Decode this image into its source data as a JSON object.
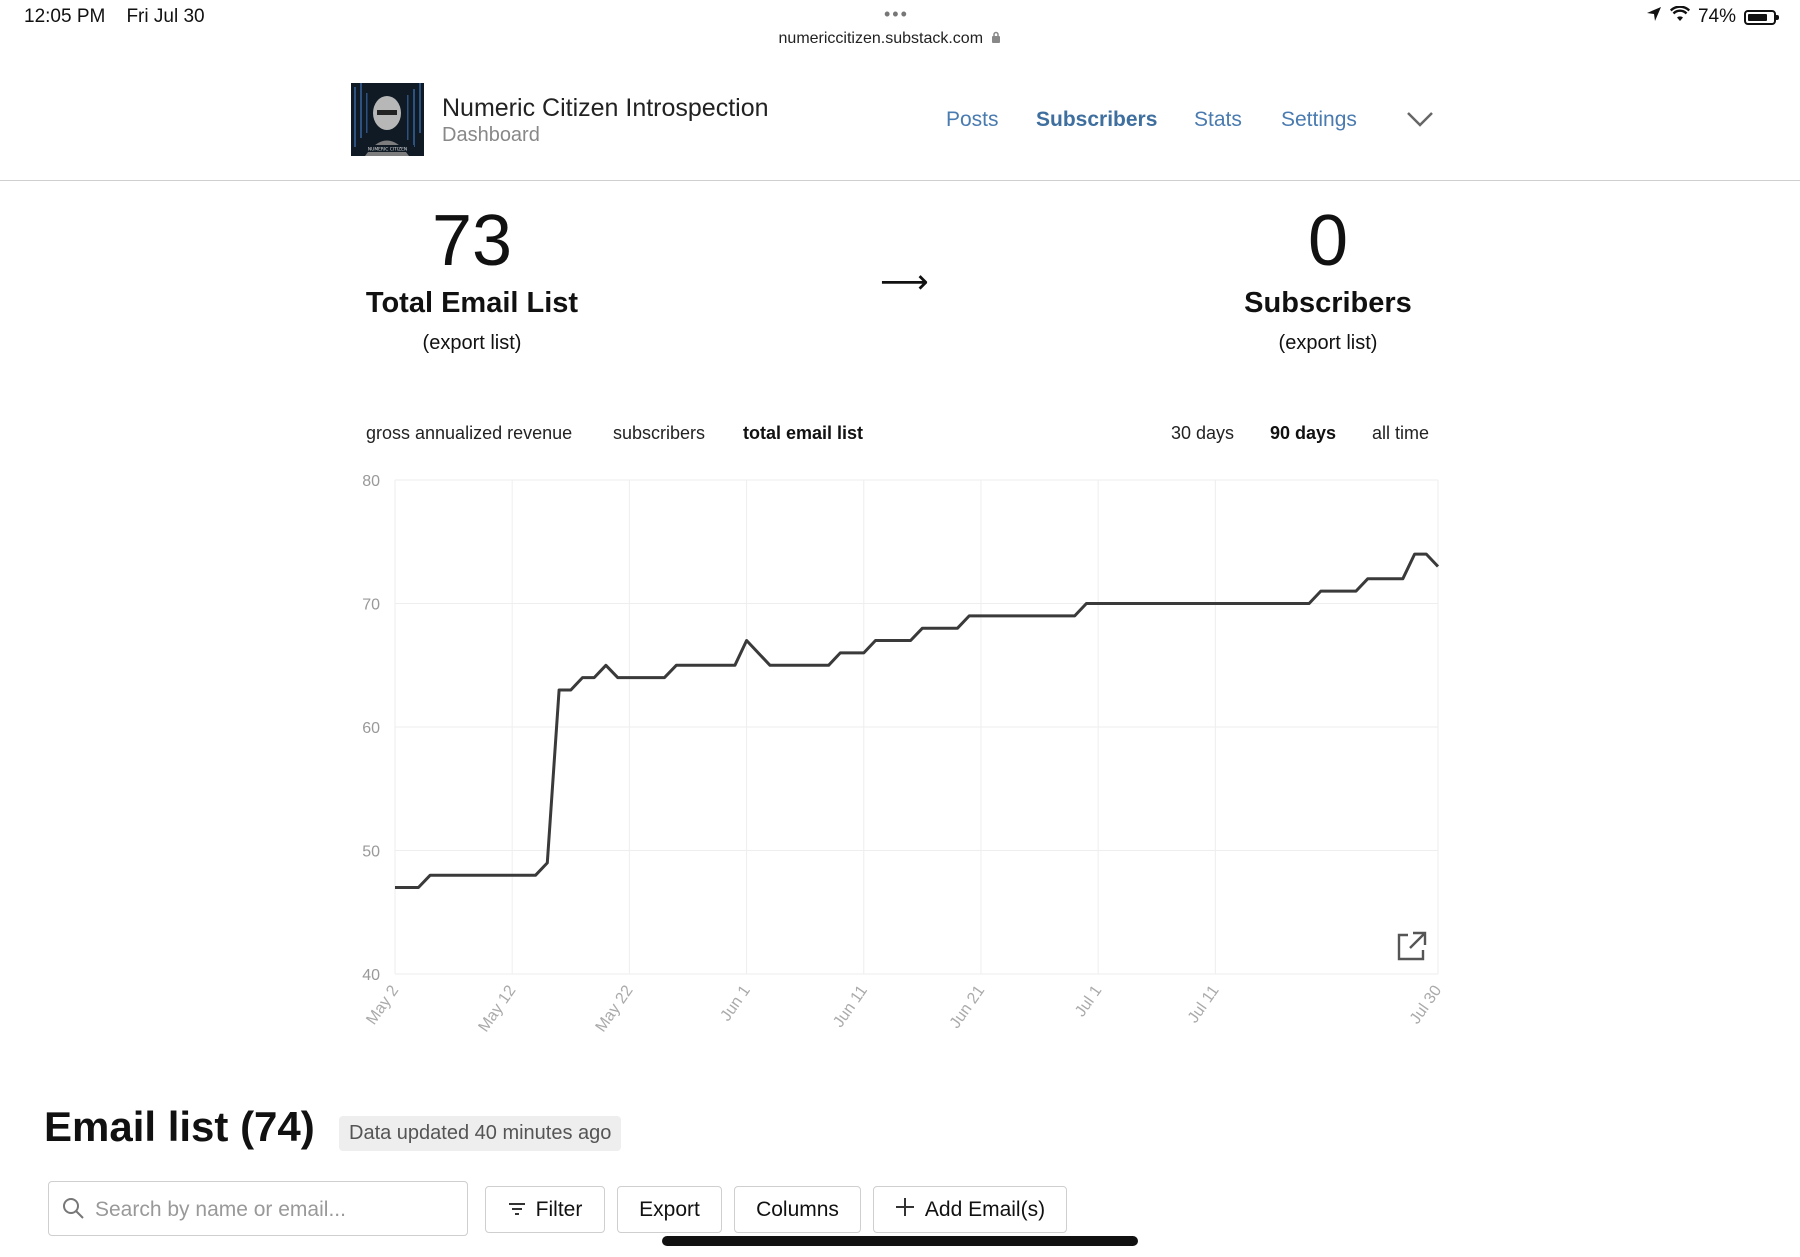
{
  "status_bar": {
    "time": "12:05 PM",
    "date": "Fri Jul 30",
    "url": "numericcitizen.substack.com",
    "battery": "74%",
    "battery_level": 0.74
  },
  "header": {
    "title": "Numeric Citizen Introspection",
    "subtitle": "Dashboard",
    "nav": [
      "Posts",
      "Subscribers",
      "Stats",
      "Settings"
    ],
    "active_nav": "Subscribers"
  },
  "stats": {
    "left": {
      "value": "73",
      "label": "Total Email List",
      "link": "(export list)"
    },
    "arrow": "⟶",
    "right": {
      "value": "0",
      "label": "Subscribers",
      "link": "(export list)"
    }
  },
  "chart_tabs": {
    "metrics": [
      "gross annualized revenue",
      "subscribers",
      "total email list"
    ],
    "active_metric": "total email list",
    "ranges": [
      "30 days",
      "90 days",
      "all time"
    ],
    "active_range": "90 days"
  },
  "chart_data": {
    "type": "line",
    "title": "",
    "xlabel": "",
    "ylabel": "",
    "ylim": [
      40,
      80
    ],
    "y_ticks": [
      80,
      70,
      60,
      50,
      40
    ],
    "x_ticks": [
      "May 2",
      "May 12",
      "May 22",
      "Jun 1",
      "Jun 11",
      "Jun 21",
      "Jul 1",
      "Jul 11",
      "Jul 30"
    ],
    "x_domain": [
      "May 2",
      "Jul 30"
    ],
    "grid": true,
    "series": [
      {
        "name": "",
        "points": [
          [
            "May 2",
            47
          ],
          [
            "May 4",
            47
          ],
          [
            "May 5",
            48
          ],
          [
            "May 14",
            48
          ],
          [
            "May 15",
            49
          ],
          [
            "May 16",
            63
          ],
          [
            "May 17",
            63
          ],
          [
            "May 18",
            64
          ],
          [
            "May 19",
            64
          ],
          [
            "May 20",
            65
          ],
          [
            "May 21",
            64
          ],
          [
            "May 25",
            64
          ],
          [
            "May 26",
            65
          ],
          [
            "May 31",
            65
          ],
          [
            "Jun 1",
            67
          ],
          [
            "Jun 3",
            65
          ],
          [
            "Jun 8",
            65
          ],
          [
            "Jun 9",
            66
          ],
          [
            "Jun 11",
            66
          ],
          [
            "Jun 12",
            67
          ],
          [
            "Jun 15",
            67
          ],
          [
            "Jun 16",
            68
          ],
          [
            "Jun 19",
            68
          ],
          [
            "Jun 20",
            69
          ],
          [
            "Jun 29",
            69
          ],
          [
            "Jun 30",
            70
          ],
          [
            "Jul 19",
            70
          ],
          [
            "Jul 20",
            71
          ],
          [
            "Jul 23",
            71
          ],
          [
            "Jul 24",
            72
          ],
          [
            "Jul 27",
            72
          ],
          [
            "Jul 28",
            74
          ],
          [
            "Jul 29",
            74
          ],
          [
            "Jul 30",
            73
          ]
        ]
      }
    ],
    "line_color": "#3a3a3a"
  },
  "email_list": {
    "title": "Email list (74)",
    "updated": "Data updated 40 minutes ago",
    "search_placeholder": "Search by name or email...",
    "buttons": {
      "filter": "Filter",
      "export": "Export",
      "columns": "Columns",
      "add": "Add Email(s)"
    }
  }
}
